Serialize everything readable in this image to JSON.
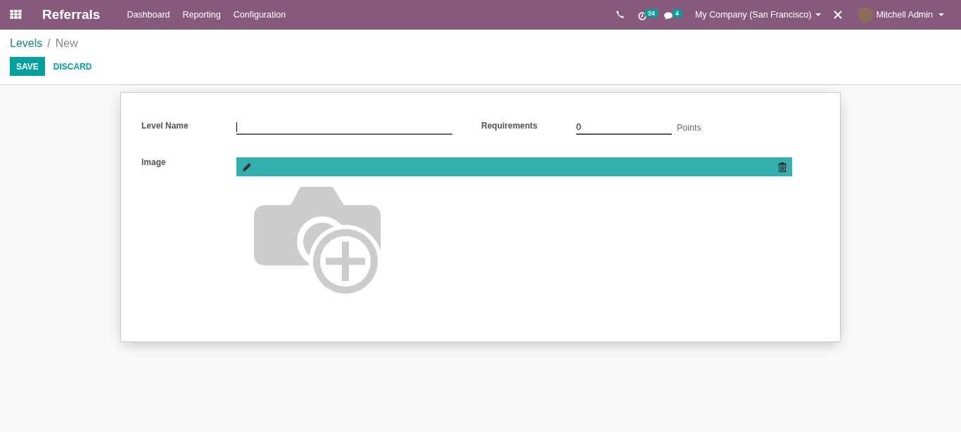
{
  "navbar": {
    "app_name": "Referrals",
    "menu": [
      "Dashboard",
      "Reporting",
      "Configuration"
    ],
    "activity_count": "24",
    "message_count": "4",
    "company": "My Company (San Francisco)",
    "user": "Mitchell Admin"
  },
  "breadcrumb": {
    "parent": "Levels",
    "separator": "/",
    "current": "New"
  },
  "buttons": {
    "save": "SAVE",
    "discard": "DISCARD"
  },
  "form": {
    "level_name": {
      "label": "Level Name"
    },
    "requirements": {
      "label": "Requirements",
      "value": "0",
      "unit": "Points"
    },
    "image": {
      "label": "Image"
    }
  }
}
